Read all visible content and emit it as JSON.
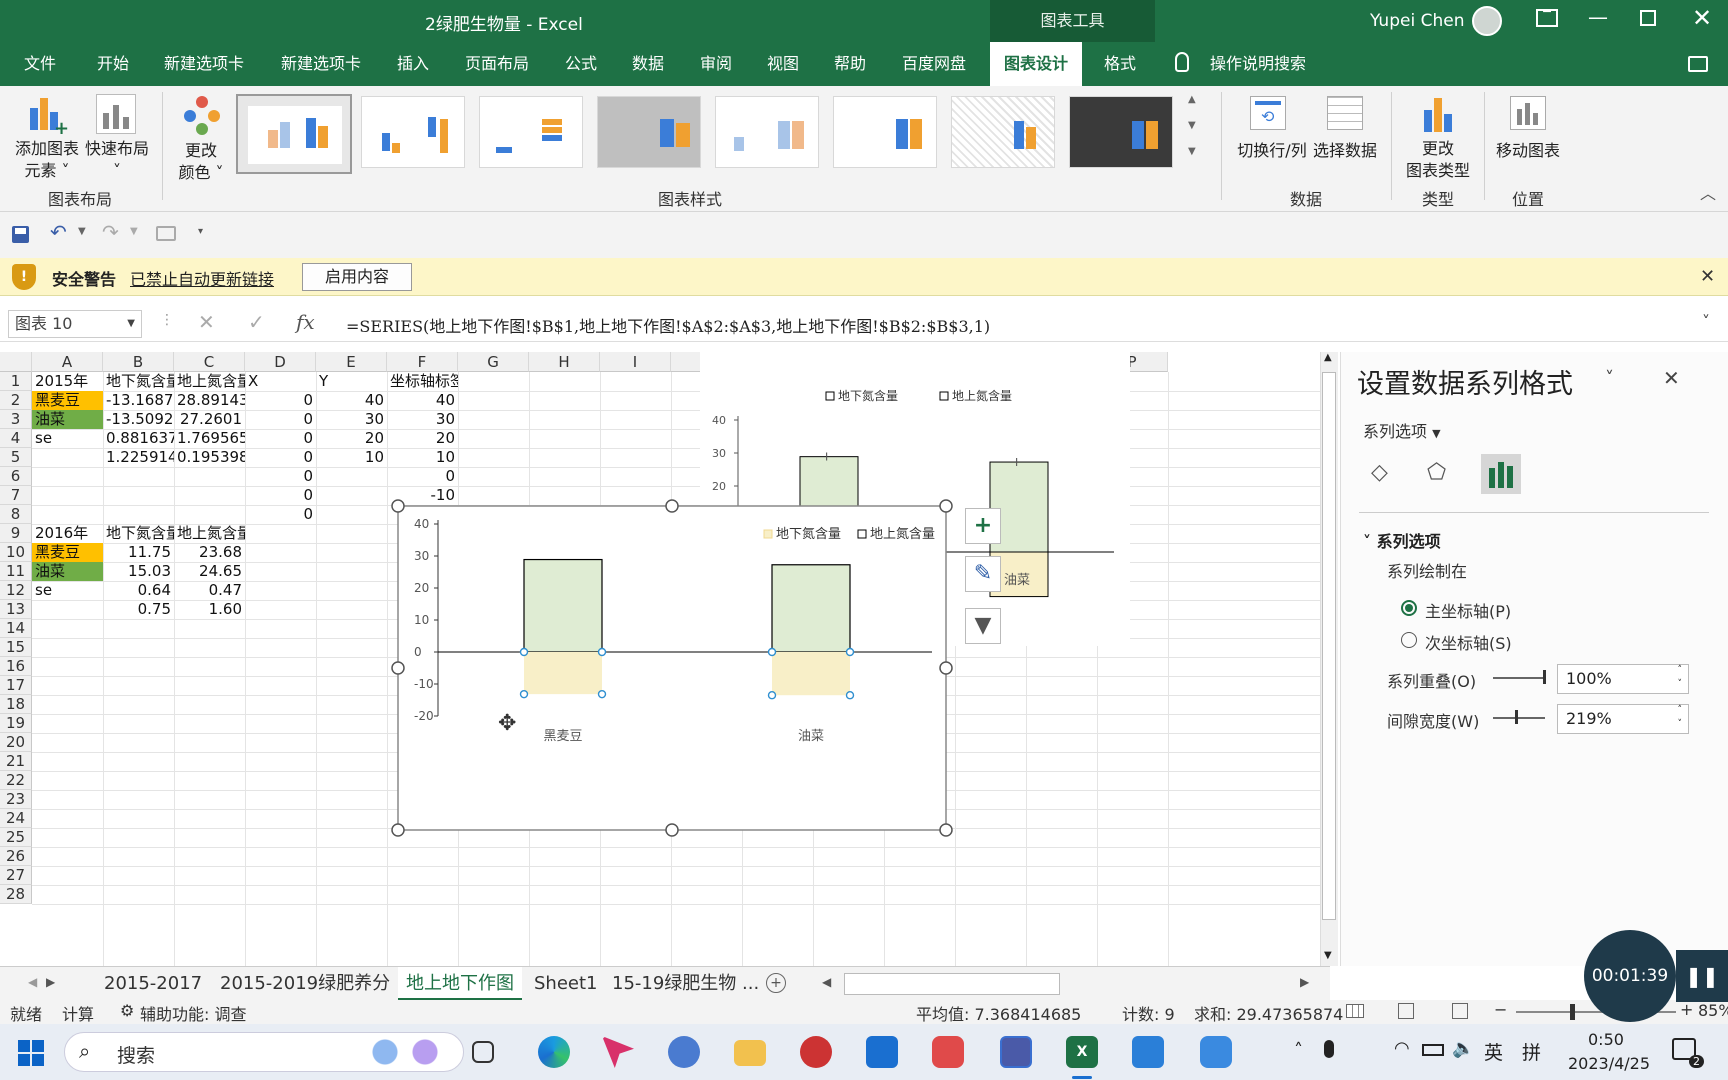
{
  "window": {
    "title": "2绿肥生物量 - Excel",
    "context_tab": "图表工具",
    "user": "Yupei Chen"
  },
  "menu": {
    "items": [
      "文件",
      "开始",
      "新建选项卡",
      "新建选项卡",
      "插入",
      "页面布局",
      "公式",
      "数据",
      "审阅",
      "视图",
      "帮助",
      "百度网盘",
      "图表设计",
      "格式"
    ],
    "active": "图表设计",
    "search": "操作说明搜索"
  },
  "ribbon": {
    "add_element_1": "添加图表",
    "add_element_2": "元素",
    "quick_layout_1": "快速布局",
    "change_color_1": "更改",
    "change_color_2": "颜色",
    "group_layout": "图表布局",
    "group_styles": "图表样式",
    "switch_row_col": "切换行/列",
    "select_data": "选择数据",
    "group_data": "数据",
    "change_type_1": "更改",
    "change_type_2": "图表类型",
    "group_type": "类型",
    "move_chart": "移动图表",
    "group_location": "位置"
  },
  "warning": {
    "title": "安全警告",
    "message": "已禁止自动更新链接",
    "button": "启用内容"
  },
  "formula": {
    "name_box": "图表 10",
    "fx": "fx",
    "text": "=SERIES(地上地下作图!$B$1,地上地下作图!$A$2:$A$3,地上地下作图!$B$2:$B$3,1)"
  },
  "sheet": {
    "columns": [
      "A",
      "B",
      "C",
      "D",
      "E",
      "F",
      "G",
      "H",
      "I",
      "J",
      "K",
      "L",
      "M",
      "N",
      "O",
      "P"
    ],
    "rows": [
      "1",
      "2",
      "3",
      "4",
      "5",
      "6",
      "7",
      "8",
      "9",
      "10",
      "11",
      "12",
      "13",
      "14",
      "15",
      "16",
      "17",
      "18",
      "19",
      "20",
      "21",
      "22",
      "23",
      "24",
      "25",
      "26",
      "27",
      "28"
    ],
    "r1": [
      "2015年",
      "地下氮含量",
      "地上氮含量",
      "X",
      "Y",
      "坐标轴标签"
    ],
    "r2": [
      "黑麦豆",
      "-13.1687",
      "28.89143",
      "0",
      "40",
      "40"
    ],
    "r3": [
      "油菜",
      "-13.5092",
      "27.2601",
      "0",
      "30",
      "30"
    ],
    "r4": [
      "se",
      "0.881637",
      "1.769565",
      "0",
      "20",
      "20"
    ],
    "r5": [
      "",
      "1.225914",
      "0.195398",
      "0",
      "10",
      "10"
    ],
    "r6": [
      "0",
      "0"
    ],
    "r7": [
      "0",
      "-10"
    ],
    "r8": [
      "0",
      "-20"
    ],
    "r9": [
      "2016年",
      "地下氮含量",
      "地上氮含量"
    ],
    "r10": [
      "黑麦豆",
      "11.75",
      "23.68"
    ],
    "r11": [
      "油菜",
      "15.03",
      "24.65"
    ],
    "r12": [
      "se",
      "0.64",
      "0.47"
    ],
    "r13": [
      "",
      "0.75",
      "1.60"
    ]
  },
  "chart_data": [
    {
      "type": "bar",
      "categories": [
        "黑麦豆",
        "油菜"
      ],
      "series": [
        {
          "name": "地下氮含量",
          "values": [
            -13.1687,
            -13.5092
          ],
          "color": "#f8efc8"
        },
        {
          "name": "地上氮含量",
          "values": [
            28.89143,
            27.2601
          ],
          "color": "#dfecd3"
        }
      ],
      "yticks": [
        40,
        30,
        20,
        10,
        0,
        -10,
        -20
      ],
      "ylim": [
        -20,
        40
      ],
      "legend": "top-right",
      "colors": {
        "border": "#000000",
        "gridline": "#000000"
      }
    },
    {
      "type": "bar",
      "categories": [
        "",
        "油菜"
      ],
      "series": [
        {
          "name": "地下氮含量",
          "values": [
            -13.1687,
            -13.5092
          ]
        },
        {
          "name": "地上氮含量",
          "values": [
            28.89143,
            27.2601
          ]
        }
      ],
      "yticks": [
        40,
        30,
        20
      ],
      "ylim": [
        -20,
        40
      ],
      "legend": "top"
    }
  ],
  "panel": {
    "title": "设置数据系列格式",
    "section_label": "系列选项",
    "group": "系列选项",
    "plot_on": "系列绘制在",
    "primary_axis": "主坐标轴(P)",
    "secondary_axis": "次坐标轴(S)",
    "overlap_label": "系列重叠(O)",
    "overlap_value": "100%",
    "gap_label": "间隙宽度(W)",
    "gap_value": "219%"
  },
  "tabs": [
    "2015-2017",
    "2015-2019绿肥养分",
    "地上地下作图",
    "Sheet1",
    "15-19绿肥生物 ..."
  ],
  "active_tab": "地上地下作图",
  "status": {
    "ready": "就绪",
    "calc": "计算",
    "accessibility": "辅助功能: 调查",
    "average": "平均值: 7.368414685",
    "count": "计数: 9",
    "sum": "求和: 29.47365874",
    "zoom": "85%"
  },
  "recording": {
    "time": "00:01:39"
  },
  "taskbar": {
    "search": "搜索",
    "ime1": "英",
    "ime2": "拼",
    "time": "0:50",
    "date": "2023/4/25",
    "badge": "2"
  }
}
